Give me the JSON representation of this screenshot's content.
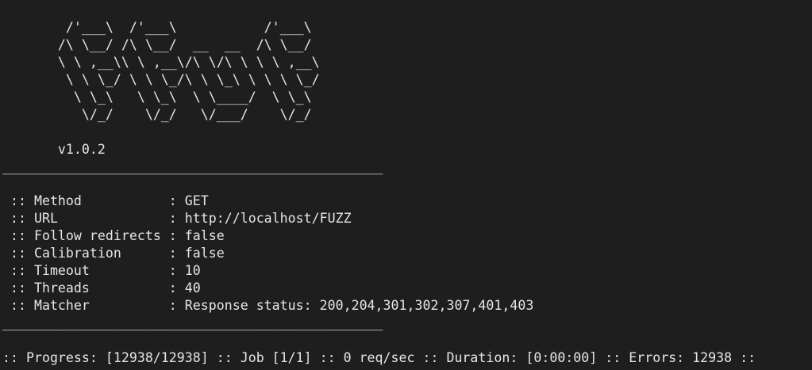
{
  "banner": {
    "ascii_art": [
      "        /'___\\  /'___\\           /'___\\",
      "       /\\ \\__/ /\\ \\__/  __  __  /\\ \\__/",
      "       \\ \\ ,__\\\\ \\ ,__\\/\\ \\/\\ \\ \\ \\ ,__\\",
      "        \\ \\ \\_/ \\ \\ \\_/\\ \\ \\_\\ \\ \\ \\ \\_/",
      "         \\ \\_\\   \\ \\_\\  \\ \\____/  \\ \\_\\",
      "          \\/_/    \\/_/   \\/___/    \\/_/"
    ],
    "version": "       v1.0.2"
  },
  "separator": "________________________________________________",
  "config": [
    {
      "key": "Method",
      "value": "GET",
      "line": " :: Method           : GET"
    },
    {
      "key": "URL",
      "value": "http://localhost/FUZZ",
      "line": " :: URL              : http://localhost/FUZZ"
    },
    {
      "key": "Follow redirects",
      "value": "false",
      "line": " :: Follow redirects : false"
    },
    {
      "key": "Calibration",
      "value": "false",
      "line": " :: Calibration      : false"
    },
    {
      "key": "Timeout",
      "value": "10",
      "line": " :: Timeout          : 10"
    },
    {
      "key": "Threads",
      "value": "40",
      "line": " :: Threads          : 40"
    },
    {
      "key": "Matcher",
      "value": "Response status: 200,204,301,302,307,401,403",
      "line": " :: Matcher          : Response status: 200,204,301,302,307,401,403"
    }
  ],
  "status_line": ":: Progress: [12938/12938] :: Job [1/1] :: 0 req/sec :: Duration: [0:00:00] :: Errors: 12938 ::",
  "colors": {
    "background": "#1e1e1e",
    "foreground": "#e6e6e6"
  }
}
